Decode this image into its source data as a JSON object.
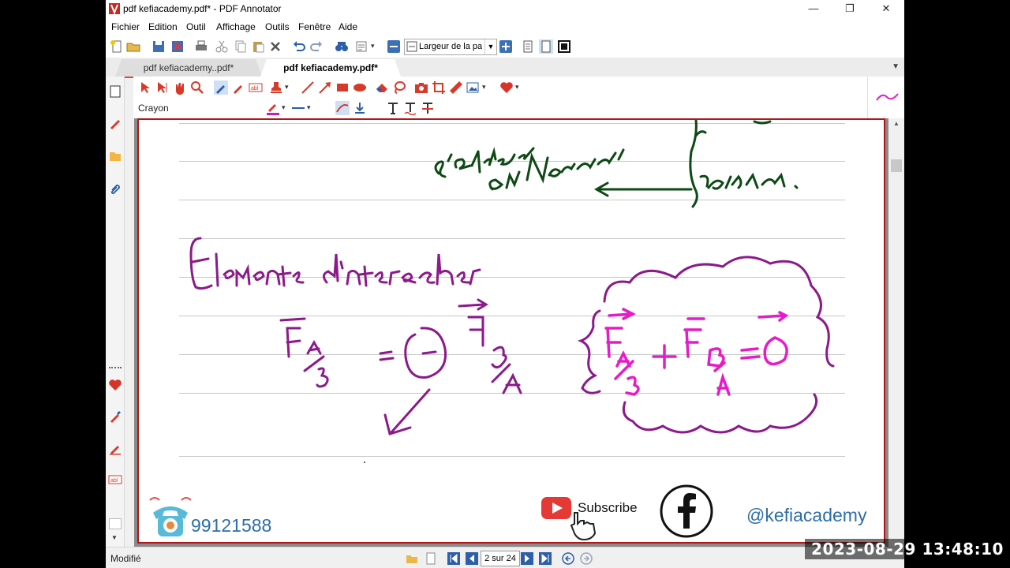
{
  "window": {
    "title": "pdf kefiacademy.pdf* - PDF Annotator",
    "controls": {
      "minimize": "—",
      "maximize": "❐",
      "close": "✕"
    }
  },
  "menu": [
    "Fichier",
    "Edition",
    "Outil",
    "Affichage",
    "Outils",
    "Fenêtre",
    "Aide"
  ],
  "toolbar": {
    "zoom_value": "Largeur de la page"
  },
  "tabs": [
    {
      "label": "pdf kefiacademy..pdf*",
      "active": false
    },
    {
      "label": "pdf kefiacademy.pdf*",
      "active": true
    }
  ],
  "annotation_toolbar": {
    "tool_label": "Crayon"
  },
  "document": {
    "handwriting": {
      "top_lines": [
        "s'exprime",
        "en Newton",
        "valeur."
      ],
      "heading": "Elements d'interaction",
      "left_formula": [
        "F",
        "A/B",
        "=",
        "-",
        "F",
        "B/A"
      ],
      "right_formula": [
        "F",
        "A/B",
        "+",
        "F",
        "B/A",
        "=",
        "0"
      ]
    },
    "ink_colors": {
      "green": "#0c4a14",
      "purple": "#8b1a8b",
      "magenta": "#e51cc8"
    }
  },
  "overlay": {
    "phone_number": "99121588",
    "subscribe_label": "Subscribe",
    "social_handle": "@kefiacademy",
    "timestamp": "2023-08-29 13:48:10"
  },
  "status": {
    "state": "Modifié",
    "page_indicator": "2 sur 24"
  },
  "colors": {
    "accent": "#d84a3a",
    "page_border": "#b01818",
    "brand_blue": "#2c6da8",
    "youtube_red": "#e53935"
  }
}
